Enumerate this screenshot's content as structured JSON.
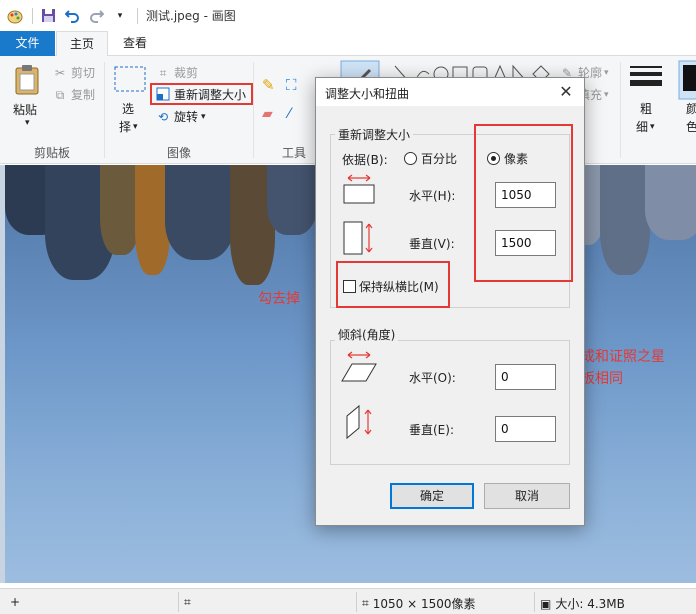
{
  "titlebar": {
    "title": "测试.jpeg - 画图"
  },
  "tabs": {
    "file": "文件",
    "home": "主页",
    "view": "查看"
  },
  "ribbon": {
    "clipboard": {
      "paste": "粘贴",
      "cut": "剪切",
      "copy": "复制",
      "group": "剪贴板"
    },
    "image": {
      "select_line1": "选",
      "select_line2": "择",
      "crop": "裁剪",
      "resize": "重新调整大小",
      "rotate": "旋转",
      "group": "图像"
    },
    "tools": {
      "group": "工具"
    },
    "shapes": {
      "outline": "轮廓",
      "fill": "填充"
    },
    "size": {
      "line1": "粗",
      "line2": "细"
    },
    "color": {
      "line1": "颜",
      "line2": "色"
    }
  },
  "annotations": {
    "uncheck": "勾去掉",
    "note_line1": "调成和证照之星",
    "note_line2": "底板相同"
  },
  "statusbar": {
    "dimensions": "1050 × 1500像素",
    "size": "大小: 4.3MB"
  },
  "dialog": {
    "title": "调整大小和扭曲",
    "resize_section": "重新调整大小",
    "by_label": "依据(B):",
    "percent": "百分比",
    "pixels": "像素",
    "horizontal_label": "水平(H):",
    "horizontal_value": "1050",
    "vertical_label": "垂直(V):",
    "vertical_value": "1500",
    "keep_ratio": "保持纵横比(M)",
    "skew_section": "倾斜(角度)",
    "skew_h_label": "水平(O):",
    "skew_h_value": "0",
    "skew_v_label": "垂直(E):",
    "skew_v_value": "0",
    "ok": "确定",
    "cancel": "取消"
  },
  "colors": {
    "accent": "#1979ca",
    "annotation_red": "#e53935"
  }
}
